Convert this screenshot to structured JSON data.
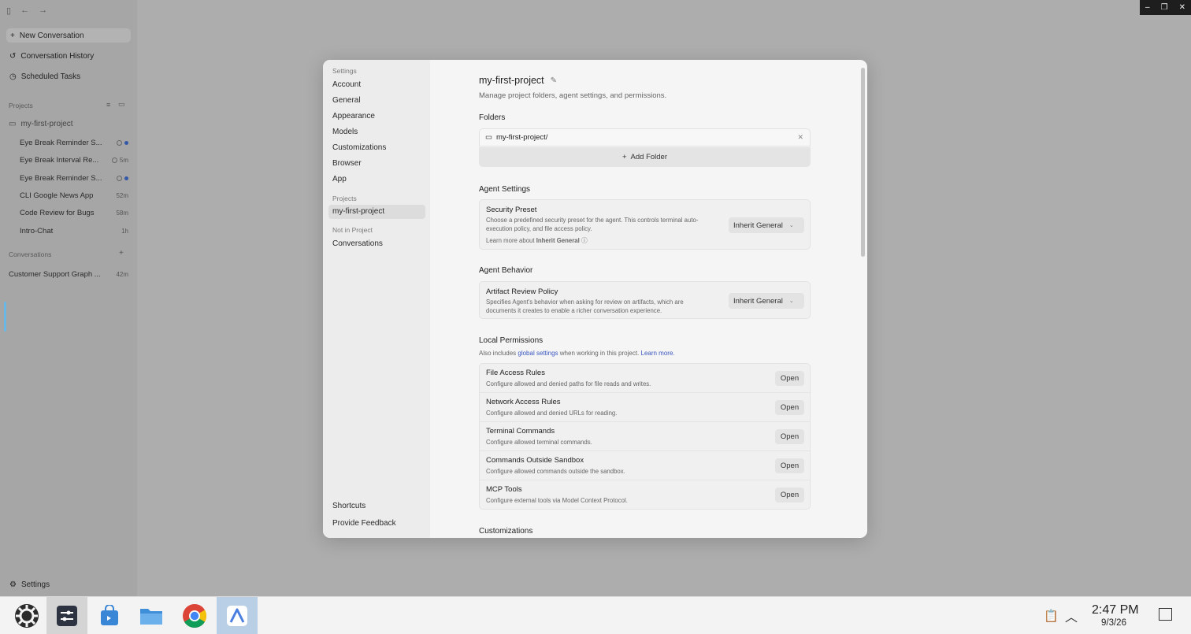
{
  "sidebar": {
    "new_conversation": "New Conversation",
    "conversation_history": "Conversation History",
    "scheduled_tasks": "Scheduled Tasks",
    "projects_label": "Projects",
    "project_name": "my-first-project",
    "project_items": [
      {
        "label": "Eye Break Reminder S...",
        "meta": ""
      },
      {
        "label": "Eye Break Interval Re...",
        "meta": "5m"
      },
      {
        "label": "Eye Break Reminder S...",
        "meta": ""
      },
      {
        "label": "CLI Google News App",
        "meta": "52m"
      },
      {
        "label": "Code Review for Bugs",
        "meta": "58m"
      },
      {
        "label": "Intro-Chat",
        "meta": "1h"
      }
    ],
    "conversations_label": "Conversations",
    "conversation_items": [
      {
        "label": "Customer Support Graph ...",
        "meta": "42m"
      }
    ],
    "settings": "Settings"
  },
  "modal": {
    "nav": {
      "settings_label": "Settings",
      "items": [
        "Account",
        "General",
        "Appearance",
        "Models",
        "Customizations",
        "Browser",
        "App"
      ],
      "projects_label": "Projects",
      "selected_project": "my-first-project",
      "not_in_project_label": "Not in Project",
      "conversations": "Conversations",
      "shortcuts": "Shortcuts",
      "feedback": "Provide Feedback"
    },
    "title": "my-first-project",
    "subtitle": "Manage project folders, agent settings, and permissions.",
    "folders": {
      "heading": "Folders",
      "folder": "my-first-project/",
      "add_folder": "Add Folder"
    },
    "agent_settings": {
      "heading": "Agent Settings",
      "title": "Security Preset",
      "desc1": "Choose a predefined security preset for the agent. This controls terminal auto-",
      "desc2": "execution policy, and file access policy.",
      "learn_prefix": "Learn more about",
      "learn_bold": "Inherit General",
      "value": "Inherit General"
    },
    "agent_behavior": {
      "heading": "Agent Behavior",
      "title": "Artifact Review Policy",
      "desc1": "Specifies Agent's behavior when asking for review on artifacts, which are",
      "desc2": "documents it creates to enable a richer conversation experience.",
      "value": "Inherit General"
    },
    "local_permissions": {
      "heading": "Local Permissions",
      "note_prefix": "Also includes",
      "note_link": "global settings",
      "note_mid": "when working in this project.",
      "note_link2": "Learn more.",
      "open_label": "Open",
      "rows": [
        {
          "title": "File Access Rules",
          "desc": "Configure allowed and denied paths for file reads and writes."
        },
        {
          "title": "Network Access Rules",
          "desc": "Configure allowed and denied URLs for reading."
        },
        {
          "title": "Terminal Commands",
          "desc": "Configure allowed terminal commands."
        },
        {
          "title": "Commands Outside Sandbox",
          "desc": "Configure allowed commands outside the sandbox."
        },
        {
          "title": "MCP Tools",
          "desc": "Configure external tools via Model Context Protocol."
        }
      ]
    },
    "customizations_heading": "Customizations"
  },
  "taskbar": {
    "time": "2:47 PM",
    "date": "9/3/26"
  }
}
